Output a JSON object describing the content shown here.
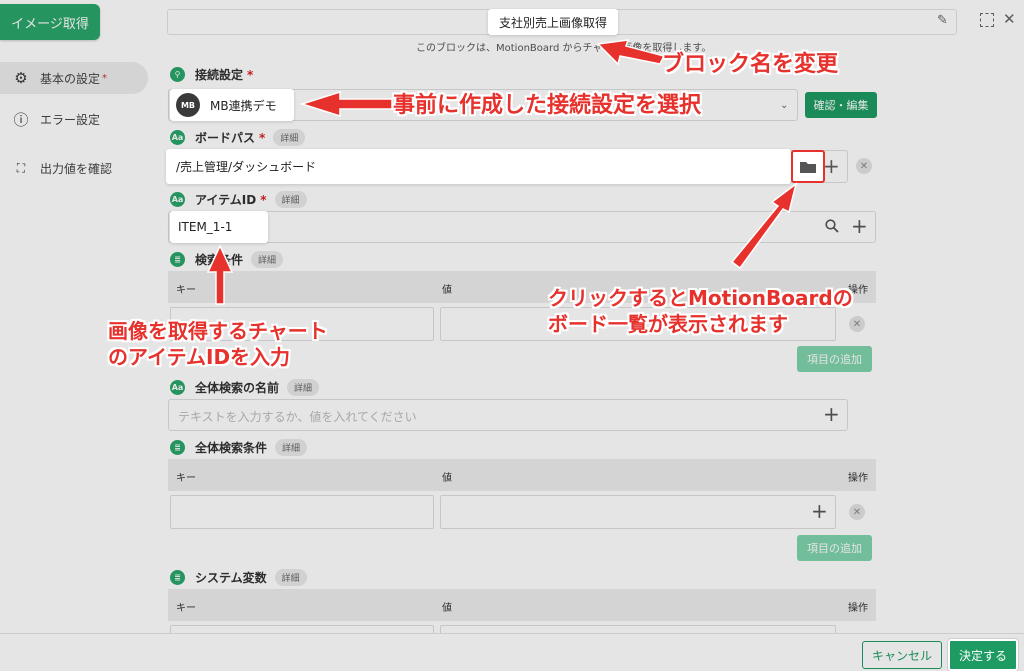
{
  "app": {
    "button_label": "イメージ取得"
  },
  "sidebar": {
    "items": [
      {
        "label": "基本の設定",
        "required_mark": "*"
      },
      {
        "label": "エラー設定"
      },
      {
        "label": "出力値を確認"
      }
    ]
  },
  "header": {
    "block_name": "支社別売上画像取得",
    "description": "このブロックは、MotionBoard からチャート画像を取得します。"
  },
  "connection": {
    "label": "接続設定",
    "required_mark": "*",
    "value": "MB連携デモ",
    "logo_text": "MB",
    "confirm_button": "確認・編集"
  },
  "board_path": {
    "label": "ボードパス",
    "required_mark": "*",
    "detail_chip": "詳細",
    "value": "/売上管理/ダッシュボード"
  },
  "item_id": {
    "label": "アイテムID",
    "required_mark": "*",
    "detail_chip": "詳細",
    "value": "ITEM_1-1"
  },
  "search_conditions": {
    "label": "検索条件",
    "detail_chip": "詳細",
    "columns": {
      "key": "キー",
      "value": "値",
      "action": "操作"
    },
    "add_button": "項目の追加"
  },
  "global_search_name": {
    "label": "全体検索の名前",
    "detail_chip": "詳細",
    "placeholder": "テキストを入力するか、値を入れてください"
  },
  "global_search_conditions": {
    "label": "全体検索条件",
    "detail_chip": "詳細",
    "columns": {
      "key": "キー",
      "value": "値",
      "action": "操作"
    },
    "add_button": "項目の追加"
  },
  "system_variables": {
    "label": "システム変数",
    "detail_chip": "詳細",
    "columns": {
      "key": "キー",
      "value": "値",
      "action": "操作"
    }
  },
  "footer": {
    "cancel_button": "キャンセル",
    "ok_button": "決定する"
  },
  "annotations": {
    "rename_block": "ブロック名を変更",
    "select_connection": "事前に作成した接続設定を選択",
    "board_list_line1": "クリックするとMotionBoardの",
    "board_list_line2": "ボード一覧が表示されます",
    "item_id_line1": "画像を取得するチャート",
    "item_id_line2": "のアイテムIDを入力"
  },
  "colors": {
    "accent": "#1e9b62",
    "annotation": "#e6312c"
  }
}
